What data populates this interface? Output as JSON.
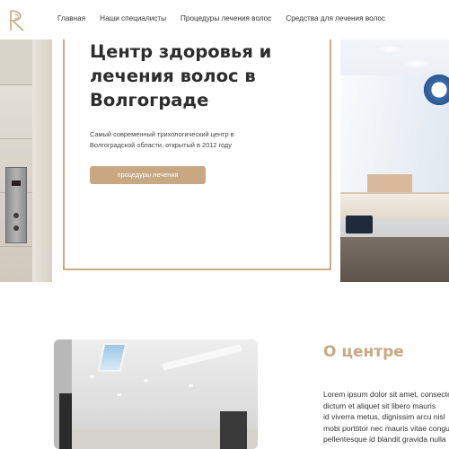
{
  "header": {
    "logo_icon": "brand-logo-icon",
    "nav": [
      {
        "label": "Главная"
      },
      {
        "label": "Наши специалисты"
      },
      {
        "label": "Процедуры лечения волос"
      },
      {
        "label": "Средства для лечения волос"
      }
    ]
  },
  "hero": {
    "title_lines": [
      "Центр здоровья и",
      "лечения волос в",
      "Волгограде"
    ],
    "description_lines": [
      "Самый современный трихологический центр в",
      "Волгоградской области, открытый в 2012 году"
    ],
    "button_label": "процедуры лечения"
  },
  "about": {
    "title": "О центре",
    "text_lines": [
      "Lorem ipsum dolor sit amet, consectetur",
      "dictum et aliquet sit libero mauris",
      "id viverra metus, dignissim arcu nisl",
      "mobi porttitor nec mauris vitae congue",
      "pellentesque id blandit gravida nulla"
    ]
  },
  "colors": {
    "accent": "#c8a882",
    "text": "#2d2d2d",
    "background": "#ffffff"
  }
}
